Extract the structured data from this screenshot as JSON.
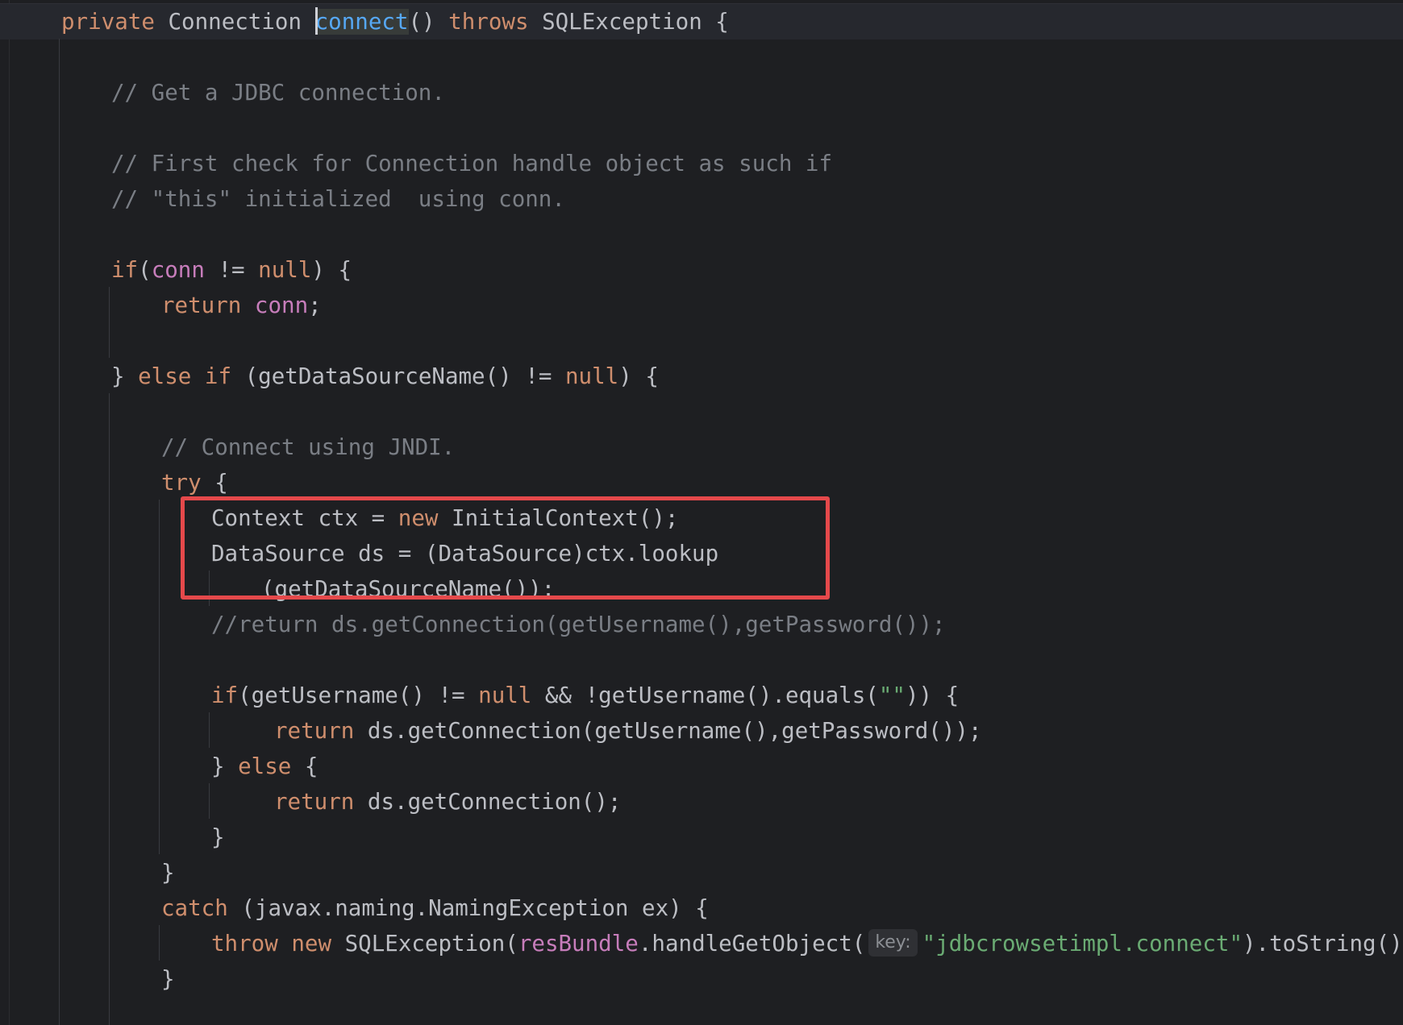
{
  "colors": {
    "background": "#1e1f22",
    "keyword": "#cf8e6d",
    "method_declaration": "#56a8f5",
    "field": "#c77dbb",
    "comment": "#7a7e85",
    "string": "#6aab73",
    "plain": "#bcbec4",
    "annotation_box": "#e5494b"
  },
  "code": {
    "l1": {
      "kw_private": "private",
      "t_connection": " Connection ",
      "fn_connect": "connect",
      "t_paren": "() ",
      "kw_throws": "throws",
      "t_rest": " SQLException {"
    },
    "l2": {
      "comment": "// Get a JDBC connection."
    },
    "l3": {
      "comment": "// First check for Connection handle object as such if"
    },
    "l4": {
      "comment": "// \"this\" initialized  using conn."
    },
    "l5": {
      "kw_if": "if",
      "t_paren": "(",
      "fld_conn": "conn",
      "t_neq": " != ",
      "kw_null": "null",
      "t_rest": ") {"
    },
    "l6": {
      "kw_return": "return",
      "t_space": " ",
      "fld_conn": "conn",
      "t_semi": ";"
    },
    "l7": {
      "t_brace": "} ",
      "kw_else": "else",
      "t_space": " ",
      "kw_if": "if",
      "t_mid": " (getDataSourceName() != ",
      "kw_null": "null",
      "t_rest": ") {"
    },
    "l8": {
      "comment": "// Connect using JNDI."
    },
    "l9": {
      "kw_try": "try",
      "t_rest": " {"
    },
    "l10": {
      "t_start": "Context ctx = ",
      "kw_new": "new",
      "t_rest": " InitialContext();"
    },
    "l11": {
      "text": "DataSource ds = (DataSource)ctx.lookup"
    },
    "l12": {
      "text": "(getDataSourceName());"
    },
    "l13": {
      "comment": "//return ds.getConnection(getUsername(),getPassword());"
    },
    "l14": {
      "kw_if": "if",
      "t_mid1": "(getUsername() != ",
      "kw_null": "null",
      "t_mid2": " && !getUsername().equals(",
      "str_empty": "\"\"",
      "t_rest": ")) {"
    },
    "l15": {
      "kw_return": "return",
      "t_rest": " ds.getConnection(getUsername(),getPassword());"
    },
    "l16": {
      "t_brace": "} ",
      "kw_else": "else",
      "t_rest": " {"
    },
    "l17": {
      "kw_return": "return",
      "t_rest": " ds.getConnection();"
    },
    "l18": {
      "text": "}"
    },
    "l19": {
      "text": "}"
    },
    "l20": {
      "kw_catch": "catch",
      "t_rest": " (javax.naming.NamingException ex) {"
    },
    "l21": {
      "kw_throw": "throw",
      "t_space": " ",
      "kw_new": "new",
      "t_mid": " SQLException(",
      "fld_resbundle": "resBundle",
      "t_method": ".handleGetObject(",
      "hint_key": "key:",
      "str_key": "\"jdbcrowsetimpl.connect\"",
      "t_rest": ").toString());"
    },
    "l22": {
      "text": "}"
    }
  }
}
